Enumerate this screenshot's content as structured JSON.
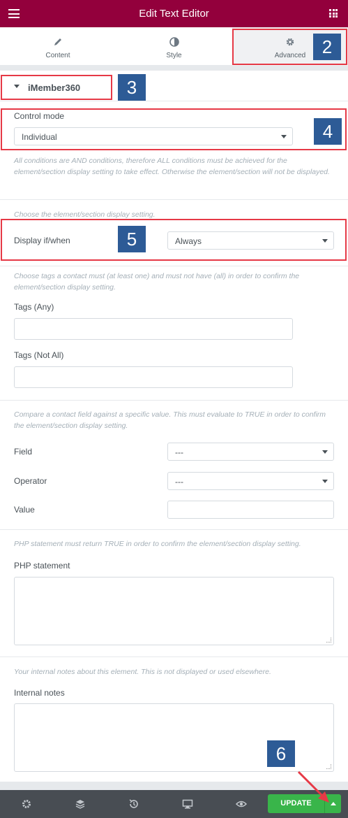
{
  "header": {
    "title": "Edit Text Editor"
  },
  "tabs": [
    {
      "label": "Content"
    },
    {
      "label": "Style"
    },
    {
      "label": "Advanced"
    }
  ],
  "section": {
    "title": "iMember360"
  },
  "control_mode": {
    "label": "Control mode",
    "value": "Individual"
  },
  "desc_conditions": "All conditions are AND conditions, therefore ALL conditions must be achieved for the element/section display setting to take effect. Otherwise the element/section will not be displayed.",
  "desc_display": "Choose the element/section display setting.",
  "display": {
    "label": "Display if/when",
    "value": "Always"
  },
  "desc_tags": "Choose tags a contact must (at least one) and must not have (all) in order to confirm the element/section display setting.",
  "tags_any": {
    "label": "Tags (Any)"
  },
  "tags_not_all": {
    "label": "Tags (Not All)"
  },
  "desc_field": "Compare a contact field against a specific value. This must evaluate to TRUE in order to confirm the element/section display setting.",
  "field": {
    "label": "Field",
    "value": "---"
  },
  "operator": {
    "label": "Operator",
    "value": "---"
  },
  "value_field": {
    "label": "Value"
  },
  "desc_php": "PHP statement must return TRUE in order to confirm the element/section display setting.",
  "php": {
    "label": "PHP statement"
  },
  "desc_notes": "Your internal notes about this element. This is not displayed or used elsewhere.",
  "notes": {
    "label": "Internal notes"
  },
  "footer": {
    "update_label": "UPDATE"
  },
  "annotations": [
    "2",
    "3",
    "4",
    "5",
    "6"
  ],
  "colors": {
    "header": "#93003c",
    "update": "#39b54a",
    "highlight": "#e63946",
    "badge": "#2d5b96"
  }
}
